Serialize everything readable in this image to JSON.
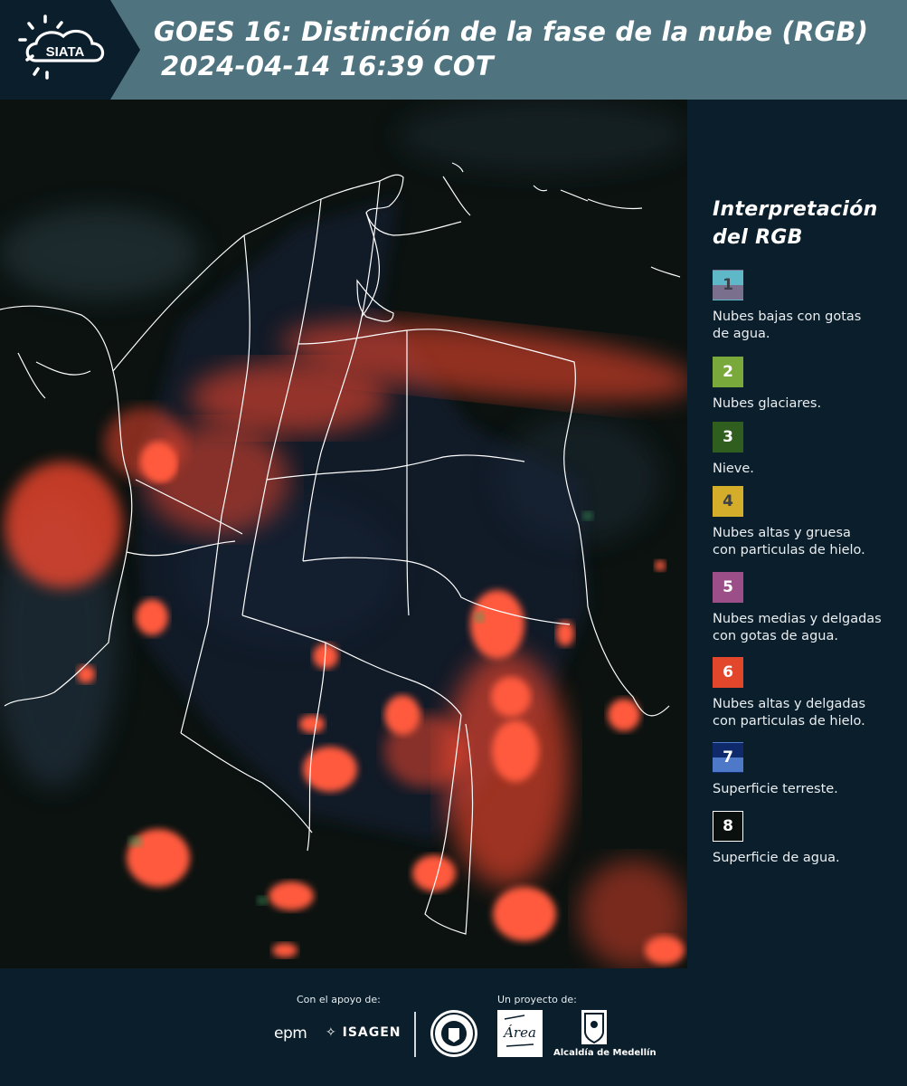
{
  "header": {
    "logo_text": "SIATA",
    "title_line1": "GOES 16: Distinción de la fase de la nube (RGB)",
    "title_line2": "2024-04-14 16:39 COT"
  },
  "legend": {
    "title_line1": "Interpretación",
    "title_line2": "del RGB",
    "items": [
      {
        "num": "1",
        "colors": [
          "#5fb8c8",
          "#7a6f8c"
        ],
        "num_color": "#3a3f4a",
        "desc": [
          "Nubes bajas con gotas",
          "de agua."
        ]
      },
      {
        "num": "2",
        "colors": [
          "#79a83b"
        ],
        "num_color": "#ffffff",
        "desc": [
          "Nubes glaciares."
        ]
      },
      {
        "num": "3",
        "colors": [
          "#2f5e1f"
        ],
        "num_color": "#ffffff",
        "desc": [
          "Nieve."
        ]
      },
      {
        "num": "4",
        "colors": [
          "#d4ae2a"
        ],
        "num_color": "#3a3f4a",
        "desc": [
          "Nubes altas y gruesa",
          "con particulas de hielo."
        ]
      },
      {
        "num": "5",
        "colors": [
          "#9b4e88"
        ],
        "num_color": "#ffffff",
        "desc": [
          "Nubes medias y delgadas",
          "con gotas de agua."
        ]
      },
      {
        "num": "6",
        "colors": [
          "#e2472c"
        ],
        "num_color": "#ffffff",
        "desc": [
          "Nubes altas y delgadas",
          "con particulas de hielo."
        ]
      },
      {
        "num": "7",
        "colors": [
          "#0e2a6b",
          "#4e78c8"
        ],
        "num_color": "#ffffff",
        "desc": [
          "Superficie terreste."
        ]
      },
      {
        "num": "8",
        "colors": [
          "#0a100d"
        ],
        "num_color": "#ffffff",
        "border": "#ffffff",
        "desc": [
          "Superficie de agua."
        ]
      }
    ]
  },
  "footer": {
    "support_label": "Con el apoyo de:",
    "project_label": "Un proyecto de:",
    "epm": "epm",
    "isagen": "ISAGEN",
    "alcaldia": "Alcaldía de Medellín",
    "area_text": "Área"
  },
  "colors": {
    "header_bg": "#4f7480",
    "logo_bg": "#0b1e2b",
    "page_bg": "#0b1e2b",
    "cloud_ice": "#ff4a2e"
  }
}
